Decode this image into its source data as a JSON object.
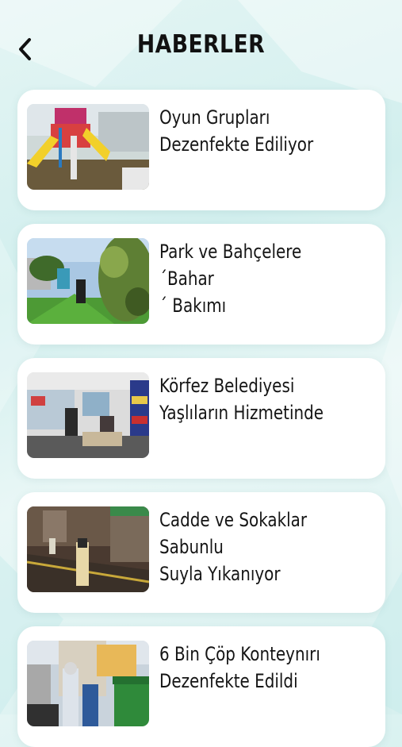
{
  "header": {
    "title": "HABERLER",
    "back_icon": "chevron-left-icon"
  },
  "news": [
    {
      "title": "Oyun Grupları\nDezenfekte Ediliyor"
    },
    {
      "title": "Park ve Bahçelere ´Bahar\n´ Bakımı"
    },
    {
      "title": "Körfez Belediyesi\nYaşlıların Hizmetinde"
    },
    {
      "title": "Cadde ve Sokaklar Sabunlu\nSuyla Yıkanıyor"
    },
    {
      "title": "6 Bin Çöp Konteynırı\nDezenfekte Edildi"
    }
  ],
  "colors": {
    "background": "#dff3f2",
    "card": "#ffffff",
    "text": "#151515"
  }
}
